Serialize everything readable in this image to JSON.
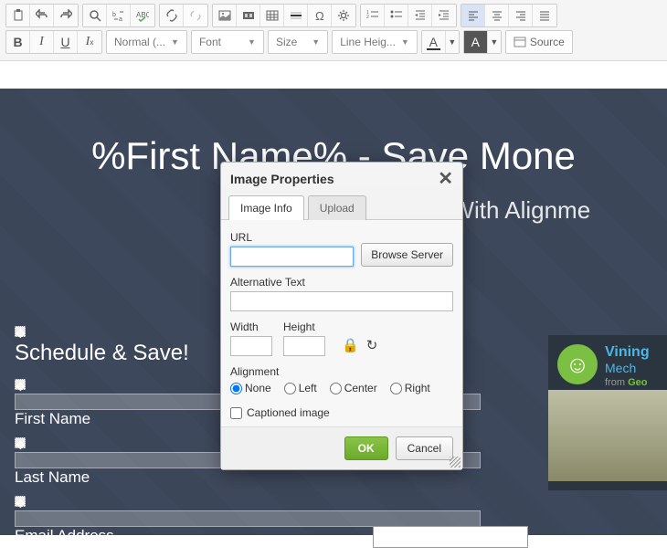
{
  "toolbar": {
    "combos": {
      "format": "Normal (...",
      "font": "Font",
      "size": "Size",
      "lineheight": "Line Heig..."
    },
    "source": "Source",
    "bold": "B",
    "italic": "I",
    "underline": "U",
    "txtcolor": "A",
    "bgcolor": "A"
  },
  "hero": {
    "title": "%First Name%  - Save Mone",
    "sub": "nge With Alignme"
  },
  "form": {
    "heading": "Schedule & Save!",
    "first": "First Name",
    "last": "Last Name",
    "email": "Email Address"
  },
  "badge": {
    "t1": "Vining",
    "t2": "Mech",
    "from": "from",
    "geo": "Geo"
  },
  "dialog": {
    "title": "Image Properties",
    "tabs": {
      "info": "Image Info",
      "upload": "Upload"
    },
    "url_lbl": "URL",
    "url_val": "",
    "browse": "Browse Server",
    "alt_lbl": "Alternative Text",
    "alt_val": "",
    "width_lbl": "Width",
    "width_val": "",
    "height_lbl": "Height",
    "height_val": "",
    "align_lbl": "Alignment",
    "align": {
      "none": "None",
      "left": "Left",
      "center": "Center",
      "right": "Right"
    },
    "captioned": "Captioned image",
    "ok": "OK",
    "cancel": "Cancel"
  }
}
